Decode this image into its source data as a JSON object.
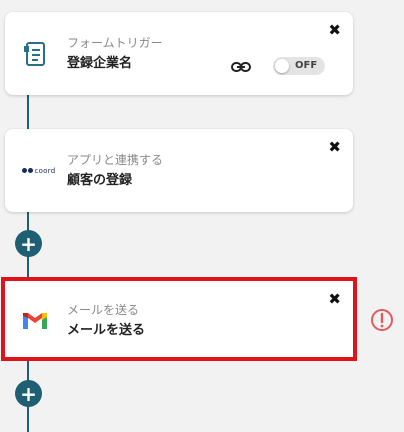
{
  "flow": {
    "steps": [
      {
        "subtitle": "フォームトリガー",
        "title": "登録企業名",
        "icon": "form-document-icon",
        "toggle_label": "OFF",
        "toggle_on": false
      },
      {
        "subtitle": "アプリと連携する",
        "title": "顧客の登録",
        "icon": "coord-app-logo",
        "logo_text": "coord"
      },
      {
        "subtitle": "メールを送る",
        "title": "メールを送る",
        "icon": "gmail-icon",
        "warning_icon": "alert-circle-icon"
      }
    ],
    "close_glyph": "✖",
    "add_glyph": "+"
  },
  "colors": {
    "connector": "#1e5f73",
    "add_button": "#1e5f73",
    "highlight": "#e0131c",
    "warning": "#e05a5f"
  }
}
